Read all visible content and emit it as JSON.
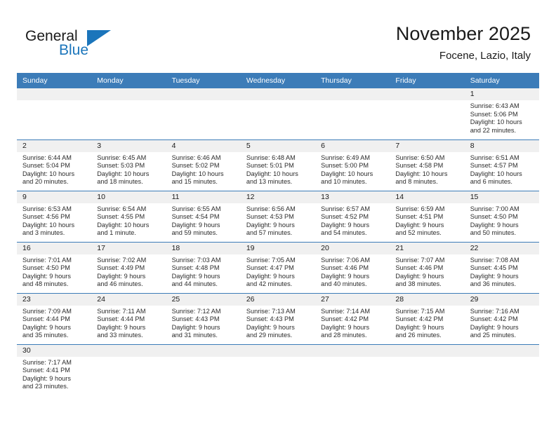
{
  "brand": {
    "name_line1": "General",
    "name_line2": "Blue",
    "triangle_icon": "triangle-icon",
    "accent_color": "#1b75bb"
  },
  "header": {
    "title": "November 2025",
    "subtitle": "Focene, Lazio, Italy"
  },
  "calendar": {
    "header_color": "#3c7cb8",
    "weekday_headers": [
      "Sunday",
      "Monday",
      "Tuesday",
      "Wednesday",
      "Thursday",
      "Friday",
      "Saturday"
    ],
    "weeks": [
      [
        {
          "day": "",
          "sunrise": "",
          "sunset": "",
          "daylight_line1": "",
          "daylight_line2": "",
          "blank": true
        },
        {
          "day": "",
          "sunrise": "",
          "sunset": "",
          "daylight_line1": "",
          "daylight_line2": "",
          "blank": true
        },
        {
          "day": "",
          "sunrise": "",
          "sunset": "",
          "daylight_line1": "",
          "daylight_line2": "",
          "blank": true
        },
        {
          "day": "",
          "sunrise": "",
          "sunset": "",
          "daylight_line1": "",
          "daylight_line2": "",
          "blank": true
        },
        {
          "day": "",
          "sunrise": "",
          "sunset": "",
          "daylight_line1": "",
          "daylight_line2": "",
          "blank": true
        },
        {
          "day": "",
          "sunrise": "",
          "sunset": "",
          "daylight_line1": "",
          "daylight_line2": "",
          "blank": true
        },
        {
          "day": "1",
          "sunrise": "Sunrise: 6:43 AM",
          "sunset": "Sunset: 5:06 PM",
          "daylight_line1": "Daylight: 10 hours",
          "daylight_line2": "and 22 minutes.",
          "blank": false
        }
      ],
      [
        {
          "day": "2",
          "sunrise": "Sunrise: 6:44 AM",
          "sunset": "Sunset: 5:04 PM",
          "daylight_line1": "Daylight: 10 hours",
          "daylight_line2": "and 20 minutes.",
          "blank": false
        },
        {
          "day": "3",
          "sunrise": "Sunrise: 6:45 AM",
          "sunset": "Sunset: 5:03 PM",
          "daylight_line1": "Daylight: 10 hours",
          "daylight_line2": "and 18 minutes.",
          "blank": false
        },
        {
          "day": "4",
          "sunrise": "Sunrise: 6:46 AM",
          "sunset": "Sunset: 5:02 PM",
          "daylight_line1": "Daylight: 10 hours",
          "daylight_line2": "and 15 minutes.",
          "blank": false
        },
        {
          "day": "5",
          "sunrise": "Sunrise: 6:48 AM",
          "sunset": "Sunset: 5:01 PM",
          "daylight_line1": "Daylight: 10 hours",
          "daylight_line2": "and 13 minutes.",
          "blank": false
        },
        {
          "day": "6",
          "sunrise": "Sunrise: 6:49 AM",
          "sunset": "Sunset: 5:00 PM",
          "daylight_line1": "Daylight: 10 hours",
          "daylight_line2": "and 10 minutes.",
          "blank": false
        },
        {
          "day": "7",
          "sunrise": "Sunrise: 6:50 AM",
          "sunset": "Sunset: 4:58 PM",
          "daylight_line1": "Daylight: 10 hours",
          "daylight_line2": "and 8 minutes.",
          "blank": false
        },
        {
          "day": "8",
          "sunrise": "Sunrise: 6:51 AM",
          "sunset": "Sunset: 4:57 PM",
          "daylight_line1": "Daylight: 10 hours",
          "daylight_line2": "and 6 minutes.",
          "blank": false
        }
      ],
      [
        {
          "day": "9",
          "sunrise": "Sunrise: 6:53 AM",
          "sunset": "Sunset: 4:56 PM",
          "daylight_line1": "Daylight: 10 hours",
          "daylight_line2": "and 3 minutes.",
          "blank": false
        },
        {
          "day": "10",
          "sunrise": "Sunrise: 6:54 AM",
          "sunset": "Sunset: 4:55 PM",
          "daylight_line1": "Daylight: 10 hours",
          "daylight_line2": "and 1 minute.",
          "blank": false
        },
        {
          "day": "11",
          "sunrise": "Sunrise: 6:55 AM",
          "sunset": "Sunset: 4:54 PM",
          "daylight_line1": "Daylight: 9 hours",
          "daylight_line2": "and 59 minutes.",
          "blank": false
        },
        {
          "day": "12",
          "sunrise": "Sunrise: 6:56 AM",
          "sunset": "Sunset: 4:53 PM",
          "daylight_line1": "Daylight: 9 hours",
          "daylight_line2": "and 57 minutes.",
          "blank": false
        },
        {
          "day": "13",
          "sunrise": "Sunrise: 6:57 AM",
          "sunset": "Sunset: 4:52 PM",
          "daylight_line1": "Daylight: 9 hours",
          "daylight_line2": "and 54 minutes.",
          "blank": false
        },
        {
          "day": "14",
          "sunrise": "Sunrise: 6:59 AM",
          "sunset": "Sunset: 4:51 PM",
          "daylight_line1": "Daylight: 9 hours",
          "daylight_line2": "and 52 minutes.",
          "blank": false
        },
        {
          "day": "15",
          "sunrise": "Sunrise: 7:00 AM",
          "sunset": "Sunset: 4:50 PM",
          "daylight_line1": "Daylight: 9 hours",
          "daylight_line2": "and 50 minutes.",
          "blank": false
        }
      ],
      [
        {
          "day": "16",
          "sunrise": "Sunrise: 7:01 AM",
          "sunset": "Sunset: 4:50 PM",
          "daylight_line1": "Daylight: 9 hours",
          "daylight_line2": "and 48 minutes.",
          "blank": false
        },
        {
          "day": "17",
          "sunrise": "Sunrise: 7:02 AM",
          "sunset": "Sunset: 4:49 PM",
          "daylight_line1": "Daylight: 9 hours",
          "daylight_line2": "and 46 minutes.",
          "blank": false
        },
        {
          "day": "18",
          "sunrise": "Sunrise: 7:03 AM",
          "sunset": "Sunset: 4:48 PM",
          "daylight_line1": "Daylight: 9 hours",
          "daylight_line2": "and 44 minutes.",
          "blank": false
        },
        {
          "day": "19",
          "sunrise": "Sunrise: 7:05 AM",
          "sunset": "Sunset: 4:47 PM",
          "daylight_line1": "Daylight: 9 hours",
          "daylight_line2": "and 42 minutes.",
          "blank": false
        },
        {
          "day": "20",
          "sunrise": "Sunrise: 7:06 AM",
          "sunset": "Sunset: 4:46 PM",
          "daylight_line1": "Daylight: 9 hours",
          "daylight_line2": "and 40 minutes.",
          "blank": false
        },
        {
          "day": "21",
          "sunrise": "Sunrise: 7:07 AM",
          "sunset": "Sunset: 4:46 PM",
          "daylight_line1": "Daylight: 9 hours",
          "daylight_line2": "and 38 minutes.",
          "blank": false
        },
        {
          "day": "22",
          "sunrise": "Sunrise: 7:08 AM",
          "sunset": "Sunset: 4:45 PM",
          "daylight_line1": "Daylight: 9 hours",
          "daylight_line2": "and 36 minutes.",
          "blank": false
        }
      ],
      [
        {
          "day": "23",
          "sunrise": "Sunrise: 7:09 AM",
          "sunset": "Sunset: 4:44 PM",
          "daylight_line1": "Daylight: 9 hours",
          "daylight_line2": "and 35 minutes.",
          "blank": false
        },
        {
          "day": "24",
          "sunrise": "Sunrise: 7:11 AM",
          "sunset": "Sunset: 4:44 PM",
          "daylight_line1": "Daylight: 9 hours",
          "daylight_line2": "and 33 minutes.",
          "blank": false
        },
        {
          "day": "25",
          "sunrise": "Sunrise: 7:12 AM",
          "sunset": "Sunset: 4:43 PM",
          "daylight_line1": "Daylight: 9 hours",
          "daylight_line2": "and 31 minutes.",
          "blank": false
        },
        {
          "day": "26",
          "sunrise": "Sunrise: 7:13 AM",
          "sunset": "Sunset: 4:43 PM",
          "daylight_line1": "Daylight: 9 hours",
          "daylight_line2": "and 29 minutes.",
          "blank": false
        },
        {
          "day": "27",
          "sunrise": "Sunrise: 7:14 AM",
          "sunset": "Sunset: 4:42 PM",
          "daylight_line1": "Daylight: 9 hours",
          "daylight_line2": "and 28 minutes.",
          "blank": false
        },
        {
          "day": "28",
          "sunrise": "Sunrise: 7:15 AM",
          "sunset": "Sunset: 4:42 PM",
          "daylight_line1": "Daylight: 9 hours",
          "daylight_line2": "and 26 minutes.",
          "blank": false
        },
        {
          "day": "29",
          "sunrise": "Sunrise: 7:16 AM",
          "sunset": "Sunset: 4:42 PM",
          "daylight_line1": "Daylight: 9 hours",
          "daylight_line2": "and 25 minutes.",
          "blank": false
        }
      ],
      [
        {
          "day": "30",
          "sunrise": "Sunrise: 7:17 AM",
          "sunset": "Sunset: 4:41 PM",
          "daylight_line1": "Daylight: 9 hours",
          "daylight_line2": "and 23 minutes.",
          "blank": false
        },
        {
          "day": "",
          "sunrise": "",
          "sunset": "",
          "daylight_line1": "",
          "daylight_line2": "",
          "blank": true
        },
        {
          "day": "",
          "sunrise": "",
          "sunset": "",
          "daylight_line1": "",
          "daylight_line2": "",
          "blank": true
        },
        {
          "day": "",
          "sunrise": "",
          "sunset": "",
          "daylight_line1": "",
          "daylight_line2": "",
          "blank": true
        },
        {
          "day": "",
          "sunrise": "",
          "sunset": "",
          "daylight_line1": "",
          "daylight_line2": "",
          "blank": true
        },
        {
          "day": "",
          "sunrise": "",
          "sunset": "",
          "daylight_line1": "",
          "daylight_line2": "",
          "blank": true
        },
        {
          "day": "",
          "sunrise": "",
          "sunset": "",
          "daylight_line1": "",
          "daylight_line2": "",
          "blank": true
        }
      ]
    ]
  }
}
